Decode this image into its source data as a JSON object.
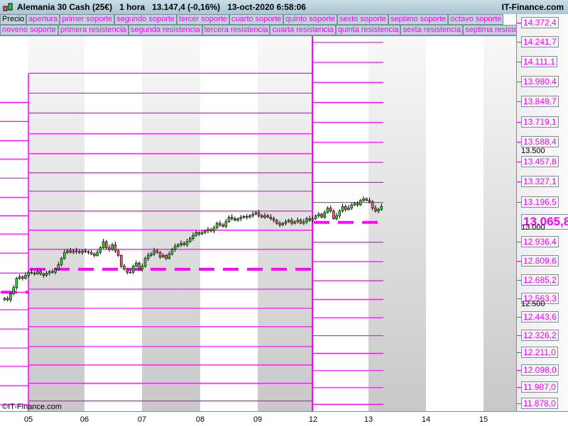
{
  "header": {
    "instrument": "Alemania 30 Cash (25€)",
    "timeframe": "1 hora",
    "price": "13.147,4 (-0,16%)",
    "datetime": "13-oct-2020 6:58:06",
    "brand": "IT-Finance.com"
  },
  "tabs_row1": [
    "Precio",
    "apertura",
    "primer soporte",
    "segundo soporte",
    "tercer soporte",
    "cuarto soporte",
    "quinto soporte",
    "sexto soporte",
    "septimo soporte",
    "octavo soporte"
  ],
  "tabs_row2": [
    "noveno soporte",
    "primera resistencia",
    "segunda resistencia",
    "tercera resistencia",
    "cuarta resistencia",
    "quinta resistencia",
    "sexta resistencia",
    "septima resistencia"
  ],
  "copyright": "©IT-Finance.com",
  "colors": {
    "level": "#ff00ff",
    "up": "#33cc33",
    "down": "#e06060"
  },
  "chart_data": {
    "type": "candlestick",
    "x_ticks": [
      "05",
      "06",
      "07",
      "08",
      "09",
      "12",
      "13",
      "14",
      "15"
    ],
    "y_ticks": [
      "13.500",
      "13.000",
      "12.500"
    ],
    "level_labels": [
      "14.372,4",
      "14.241,7",
      "14.111,1",
      "13.980,4",
      "13.849,7",
      "13.719,1",
      "13.588,4",
      "13.457,8",
      "13.327,1",
      "13.196,5",
      "12.936,4",
      "12.809,6",
      "12.685,2",
      "12.563,3",
      "12.443,6",
      "12.326,2",
      "12.211,0",
      "12.098,0",
      "11.987,0",
      "11.878,0"
    ],
    "current_label": "13.065,8",
    "levels": {
      "period1": [
        13850,
        13725,
        13600,
        13480,
        13355,
        13230,
        13110,
        12990,
        12865,
        12735,
        12610,
        12495,
        12370,
        12245,
        12125,
        12000,
        11875
      ],
      "period1_pivot": 12610,
      "period2": [
        14040,
        13910,
        13780,
        13645,
        13515,
        13390,
        13270,
        13140,
        13015,
        12890,
        12630,
        12505,
        12385,
        12255,
        12135,
        12015,
        11900,
        11785,
        11685
      ],
      "period2_pivot": 12760,
      "period3": [
        14241.7,
        14111.1,
        13980.4,
        13849.7,
        13719.1,
        13588.4,
        13457.8,
        13327.1,
        13196.5,
        12936.4,
        12809.6,
        12685.2,
        12563.3,
        12443.6,
        12326.2,
        12211.0,
        12098.0,
        11987.0,
        11878.0
      ],
      "period3_pivot": 13065.8
    },
    "closes": [
      12570,
      12560,
      12600,
      12640,
      12700,
      12710,
      12700,
      12720,
      12740,
      12735,
      12730,
      12745,
      12730,
      12720,
      12735,
      12745,
      12740,
      12760,
      12790,
      12830,
      12870,
      12880,
      12870,
      12880,
      12875,
      12870,
      12880,
      12875,
      12870,
      12860,
      12850,
      12870,
      12900,
      12940,
      12900,
      12890,
      12920,
      12880,
      12850,
      12780,
      12760,
      12740,
      12740,
      12780,
      12800,
      12760,
      12780,
      12830,
      12850,
      12860,
      12880,
      12870,
      12840,
      12850,
      12830,
      12860,
      12890,
      12910,
      12920,
      12930,
      12920,
      12940,
      12960,
      12980,
      13000,
      12990,
      13000,
      13010,
      13020,
      13010,
      13030,
      13060,
      13050,
      13040,
      13070,
      13100,
      13090,
      13080,
      13090,
      13100,
      13105,
      13100,
      13110,
      13120,
      13130,
      13110,
      13100,
      13110,
      13100,
      13090,
      13080,
      13060,
      13050,
      13060,
      13070,
      13080,
      13060,
      13070,
      13080,
      13060,
      13070,
      13090,
      13080,
      13090,
      13110,
      13120,
      13100,
      13130,
      13160,
      13140,
      13090,
      13110,
      13140,
      13170,
      13150,
      13160,
      13180,
      13190,
      13180,
      13210,
      13220,
      13210,
      13200,
      13160,
      13140,
      13150,
      13170
    ]
  }
}
